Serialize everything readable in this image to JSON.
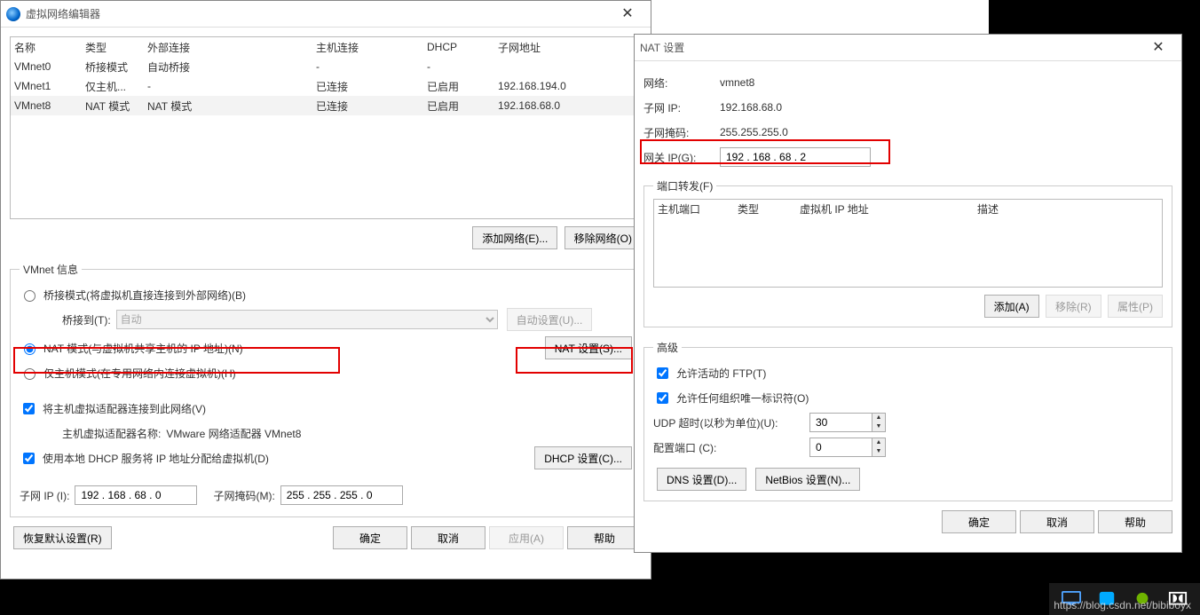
{
  "editor": {
    "title": "虚拟网络编辑器",
    "table": {
      "headers": [
        "名称",
        "类型",
        "外部连接",
        "主机连接",
        "DHCP",
        "子网地址"
      ],
      "rows": [
        {
          "name": "VMnet0",
          "type": "桥接模式",
          "ext": "自动桥接",
          "host": "-",
          "dhcp": "-",
          "subnet": ""
        },
        {
          "name": "VMnet1",
          "type": "仅主机...",
          "ext": "-",
          "host": "已连接",
          "dhcp": "已启用",
          "subnet": "192.168.194.0"
        },
        {
          "name": "VMnet8",
          "type": "NAT 模式",
          "ext": "NAT 模式",
          "host": "已连接",
          "dhcp": "已启用",
          "subnet": "192.168.68.0"
        }
      ]
    },
    "add_network_btn": "添加网络(E)...",
    "remove_network_btn": "移除网络(O)",
    "info_legend": "VMnet 信息",
    "mode_bridge": "桥接模式(将虚拟机直接连接到外部网络)(B)",
    "bridge_to_label": "桥接到(T):",
    "bridge_to_value": "自动",
    "auto_settings_btn": "自动设置(U)...",
    "mode_nat": "NAT 模式(与虚拟机共享主机的 IP 地址)(N)",
    "nat_settings_btn": "NAT 设置(S)...",
    "mode_host": "仅主机模式(在专用网络内连接虚拟机)(H)",
    "connect_host_adapter": "将主机虚拟适配器连接到此网络(V)",
    "host_adapter_name_label": "主机虚拟适配器名称:",
    "host_adapter_name_value": "VMware 网络适配器 VMnet8",
    "use_local_dhcp": "使用本地 DHCP 服务将 IP 地址分配给虚拟机(D)",
    "dhcp_settings_btn": "DHCP 设置(C)...",
    "subnet_ip_label": "子网 IP (I):",
    "subnet_ip_value": "192 . 168 . 68 . 0",
    "subnet_mask_label": "子网掩码(M):",
    "subnet_mask_value": "255 . 255 . 255 . 0",
    "restore_btn": "恢复默认设置(R)",
    "ok_btn": "确定",
    "cancel_btn": "取消",
    "apply_btn": "应用(A)",
    "help_btn": "帮助"
  },
  "nat": {
    "title": "NAT 设置",
    "network_label": "网络:",
    "network_value": "vmnet8",
    "subnet_ip_label": "子网 IP:",
    "subnet_ip_value": "192.168.68.0",
    "subnet_mask_label": "子网掩码:",
    "subnet_mask_value": "255.255.255.0",
    "gateway_label": "网关 IP(G):",
    "gateway_value": "192 . 168 . 68 . 2",
    "port_forward_legend": "端口转发(F)",
    "pf_headers": [
      "主机端口",
      "类型",
      "虚拟机 IP 地址",
      "描述"
    ],
    "add_btn": "添加(A)",
    "remove_btn": "移除(R)",
    "props_btn": "属性(P)",
    "advanced_legend": "高级",
    "allow_active_ftp": "允许活动的 FTP(T)",
    "allow_any_oui": "允许任何组织唯一标识符(O)",
    "udp_timeout_label": "UDP 超时(以秒为单位)(U):",
    "udp_timeout_value": "30",
    "config_port_label": "配置端口 (C):",
    "config_port_value": "0",
    "dns_btn": "DNS 设置(D)...",
    "netbios_btn": "NetBios 设置(N)...",
    "ok_btn": "确定",
    "cancel_btn": "取消",
    "help_btn": "帮助"
  },
  "watermark": "https://blog.csdn.net/bibiboyx"
}
